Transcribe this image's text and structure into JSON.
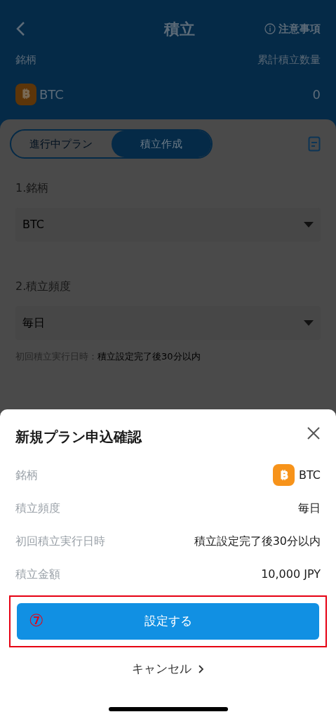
{
  "header": {
    "title": "積立",
    "notice_link": "注意事項",
    "column_labels": [
      "銘柄",
      "累計積立数量"
    ],
    "holding": {
      "symbol": "BTC",
      "quantity": "0"
    }
  },
  "tabs": [
    {
      "label": "進行中プラン",
      "selected": false
    },
    {
      "label": "積立作成",
      "selected": true
    }
  ],
  "form": [
    {
      "label": "1.銘柄",
      "value": "BTC"
    },
    {
      "label": "2.積立頻度",
      "value": "毎日"
    }
  ],
  "first_run": {
    "label": "初回積立実行日時：",
    "value": "積立設定完了後30分以内"
  },
  "dialog": {
    "title": "新規プラン申込確認",
    "rows": [
      {
        "kind": "coin",
        "label": "銘柄",
        "value": "BTC"
      },
      {
        "kind": "text",
        "label": "積立頻度",
        "value": "毎日"
      },
      {
        "kind": "text",
        "label": "初回積立実行日時",
        "value": "積立設定完了後30分以内"
      },
      {
        "kind": "text",
        "label": "積立金額",
        "value": "10,000 JPY"
      }
    ],
    "confirm_button": "設定する",
    "annotation_mark": "⑦",
    "cancel_link": "キャンセル"
  }
}
